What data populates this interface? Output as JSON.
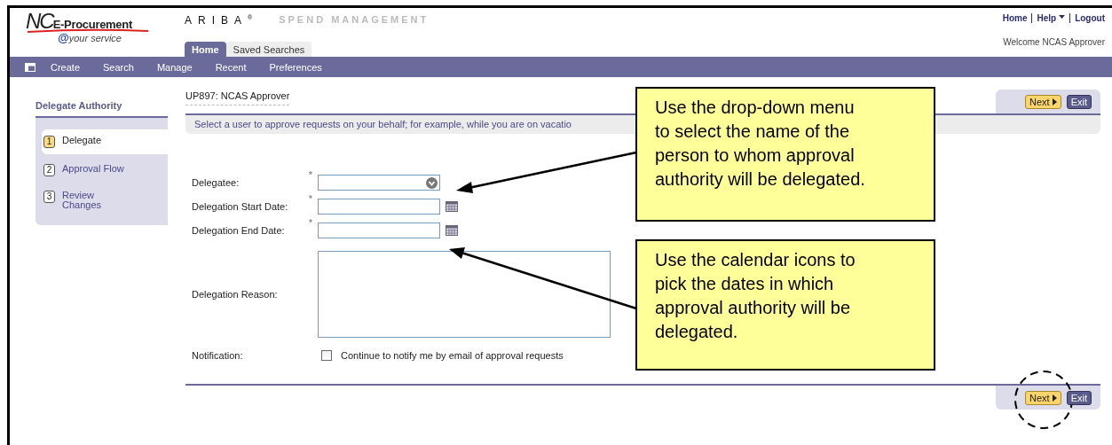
{
  "header": {
    "logo": {
      "initials": "NC",
      "name": "E-Procurement",
      "at": "@",
      "tagline": "your service"
    },
    "brand": "ARIBA",
    "brand_mark": "®",
    "product": "SPEND MANAGEMENT",
    "top_links": [
      {
        "label": "Home",
        "dropdown": false
      },
      {
        "label": "Help",
        "dropdown": true
      },
      {
        "label": "Logout",
        "dropdown": false
      }
    ],
    "welcome": "Welcome NCAS Approver",
    "tabs": [
      {
        "label": "Home",
        "selected": true
      },
      {
        "label": "Saved Searches",
        "selected": false
      }
    ]
  },
  "nav": [
    "Create",
    "Search",
    "Manage",
    "Recent",
    "Preferences"
  ],
  "sidebar": {
    "title": "Delegate Authority",
    "steps": [
      {
        "number": "1",
        "label": "Delegate",
        "selected": true
      },
      {
        "number": "2",
        "label": "Approval Flow",
        "selected": false
      },
      {
        "number": "3",
        "label": "Review Changes",
        "selected": false
      }
    ]
  },
  "page": {
    "heading": "UP897: NCAS Approver",
    "instructions": "Select a user to approve requests on your behalf; for example, while you are on vacatio",
    "top_buttons": [
      {
        "label": "Next",
        "kind": "next",
        "circled": false
      },
      {
        "label": "Exit",
        "kind": "exit",
        "circled": false
      }
    ],
    "bottom_buttons": [
      {
        "label": "Next",
        "kind": "next",
        "circled": true
      },
      {
        "label": "Exit",
        "kind": "exit",
        "circled": false
      }
    ]
  },
  "form": {
    "fields": [
      {
        "label": "Delegatee:",
        "kind": "dropdown",
        "marker": "*"
      },
      {
        "label": "Delegation Start Date:",
        "kind": "date",
        "marker": "*"
      },
      {
        "label": "Delegation End Date:",
        "kind": "date",
        "marker": "*"
      },
      {
        "label": "Delegation Reason:",
        "kind": "textarea"
      },
      {
        "label": "Notification:",
        "kind": "checkbox",
        "checked": false,
        "text": "Continue to notify me by email of approval requests"
      }
    ]
  },
  "callouts": [
    {
      "lines": [
        "Use the drop-down menu",
        "to select the name of the",
        "person to whom approval",
        "authority will be delegated."
      ]
    },
    {
      "lines": [
        "Use the calendar icons to",
        "pick the dates in which",
        "approval authority will be",
        "delegated."
      ]
    }
  ]
}
